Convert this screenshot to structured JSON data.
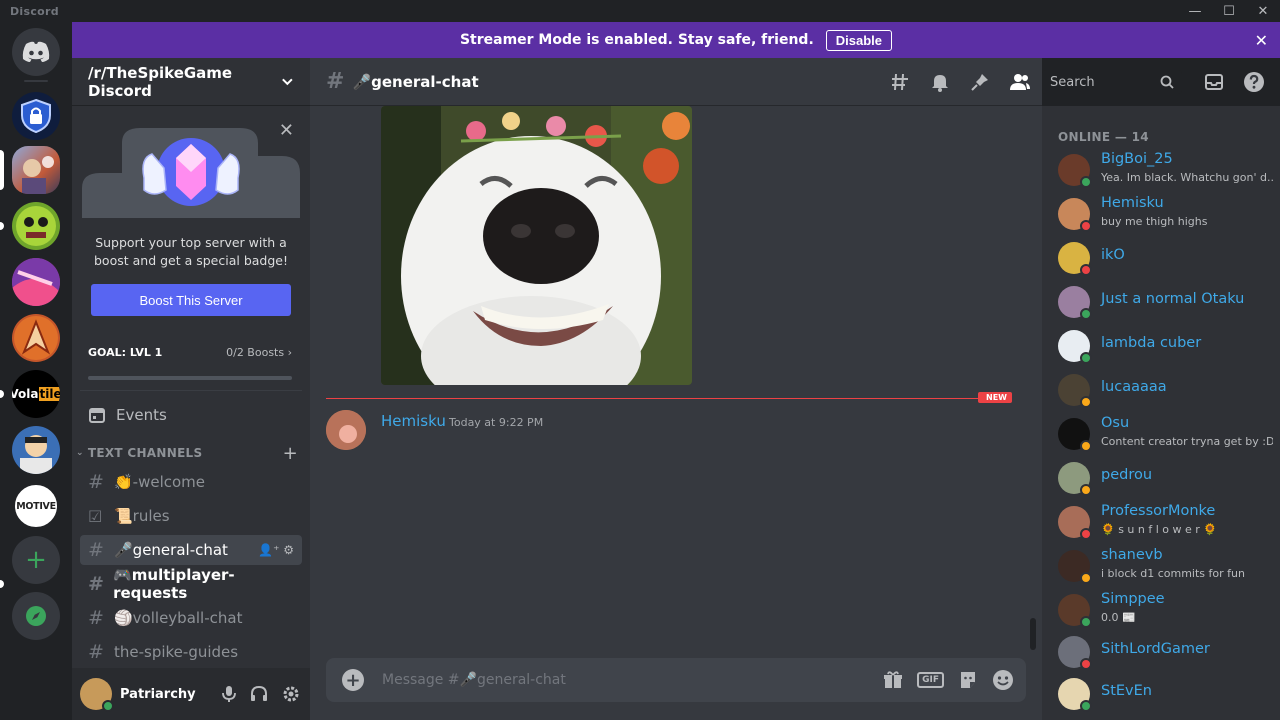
{
  "app": {
    "brand": "Discord"
  },
  "window": {
    "minimize": "—",
    "maximize": "☐",
    "close": "✕"
  },
  "banner": {
    "text": "Streamer Mode is enabled. Stay safe, friend.",
    "button": "Disable",
    "close": "✕"
  },
  "servers": [
    {
      "name": "home",
      "color": "#36393f"
    },
    {
      "name": "security",
      "color": "#1e3a8a"
    },
    {
      "name": "thespikegame",
      "color": "#6b7fa3"
    },
    {
      "name": "green-monster",
      "color": "#6fa52b"
    },
    {
      "name": "pink-pattern",
      "color": "#c0367b"
    },
    {
      "name": "flame-logo",
      "color": "#c4562a"
    },
    {
      "name": "volatile",
      "color": "#000000",
      "label": "Vola",
      "label2": "tile"
    },
    {
      "name": "avatar-blue",
      "color": "#3b6fb6"
    },
    {
      "name": "motive",
      "color": "#ffffff",
      "label": "MOTIVE"
    }
  ],
  "sidebar": {
    "guild_name": "/r/TheSpikeGame Discord",
    "boost": {
      "text": "Support your top server with a boost and get a special badge!",
      "button": "Boost This Server",
      "goal_label": "GOAL: LVL 1",
      "goal_count": "0/2 Boosts ›",
      "progress": 0
    },
    "events": "Events",
    "category": "TEXT CHANNELS",
    "channels": [
      {
        "name": "👏-welcome",
        "icon": "#"
      },
      {
        "name": "📜rules",
        "icon": "☑"
      },
      {
        "name": "🎤general-chat",
        "icon": "#"
      },
      {
        "name": "🎮multiplayer-requests",
        "icon": "#"
      },
      {
        "name": "🏐volleyball-chat",
        "icon": "#"
      },
      {
        "name": "the-spike-guides",
        "icon": "#"
      }
    ]
  },
  "user": {
    "name": "Patriarchy",
    "avatar_color": "#c79a5a",
    "status_color": "#3ba55c"
  },
  "chat": {
    "channel": "🎤general-chat",
    "new_label": "NEW",
    "message": {
      "author": "Hemisku",
      "time": "Today at 9:22 PM"
    },
    "composer_placeholder": "Message #🎤general-chat",
    "gif": "GIF"
  },
  "toolbar": {
    "search_placeholder": "Search"
  },
  "members": {
    "heading": "ONLINE — 14",
    "list": [
      {
        "name": "BigBoi_25",
        "status": "Yea. Im black. Whatchu gon' d...",
        "avatar": "#6a3b2a",
        "dot": "#3ba55c"
      },
      {
        "name": "Hemisku",
        "status": "buy me thigh highs",
        "avatar": "#c8875a",
        "dot": "#ed4245"
      },
      {
        "name": "ikO",
        "status": "",
        "avatar": "#d9b342",
        "dot": "#ed4245"
      },
      {
        "name": "Just a normal Otaku",
        "status": "",
        "avatar": "#9a7fa0",
        "dot": "#3ba55c"
      },
      {
        "name": "lambda cuber",
        "status": "",
        "avatar": "#e8edf2",
        "dot": "#3ba55c"
      },
      {
        "name": "lucaaaaa",
        "status": "",
        "avatar": "#4b4234",
        "dot": "#faa81a"
      },
      {
        "name": "Osu",
        "status": "Content creator tryna get by :D",
        "avatar": "#111111",
        "dot": "#faa81a"
      },
      {
        "name": "pedrou",
        "status": "",
        "avatar": "#8d9a7e",
        "dot": "#faa81a"
      },
      {
        "name": "ProfessorMonke",
        "status": "🌻 s u n f l o w e r 🌻",
        "avatar": "#a86d58",
        "dot": "#ed4245"
      },
      {
        "name": "shanevb",
        "status": "i block d1 commits for fun",
        "avatar": "#3c2a24",
        "dot": "#faa81a"
      },
      {
        "name": "Simppee",
        "status": "0.0 📰",
        "avatar": "#5a3a2a",
        "dot": "#3ba55c"
      },
      {
        "name": "SithLordGamer",
        "status": "",
        "avatar": "#6c6f7a",
        "dot": "#ed4245"
      },
      {
        "name": "StEvEn",
        "status": "",
        "avatar": "#e6d6b0",
        "dot": "#3ba55c"
      }
    ]
  }
}
